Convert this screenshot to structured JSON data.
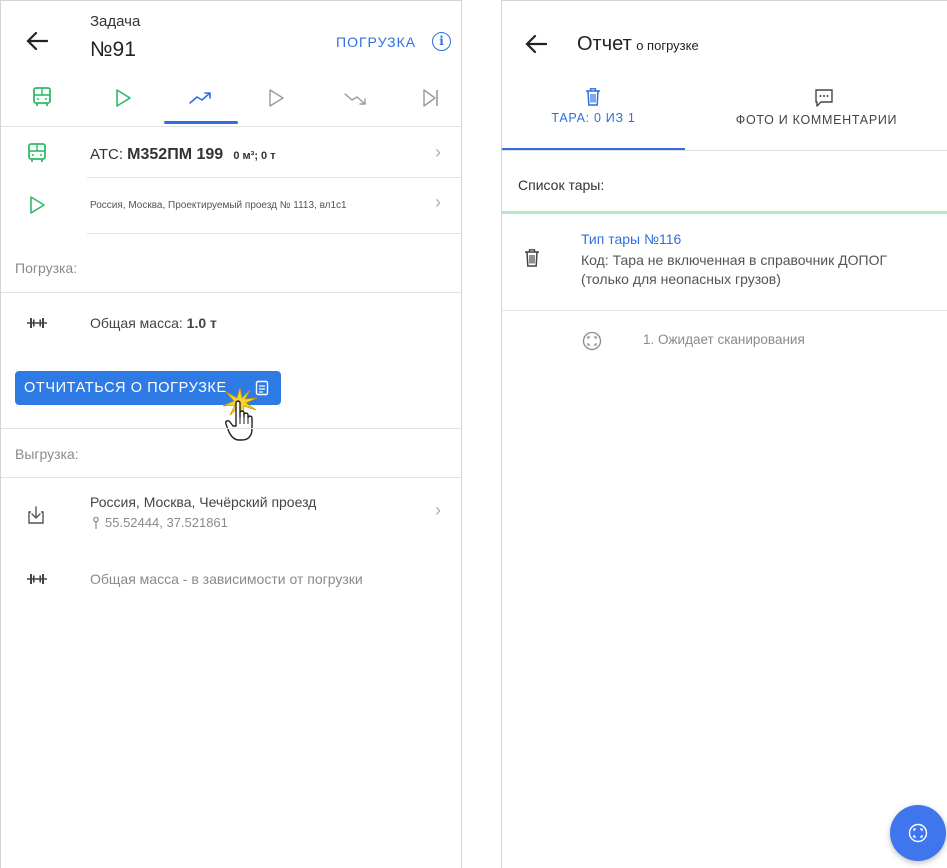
{
  "left": {
    "header": {
      "task_label": "Задача",
      "task_number": "№91",
      "stage": "ПОГРУЗКА",
      "info_icon": "info-icon"
    },
    "tabs": [
      {
        "icon": "bus-icon"
      },
      {
        "icon": "play-icon"
      },
      {
        "icon": "trend-up-icon",
        "active": true
      },
      {
        "icon": "play-outline-icon"
      },
      {
        "icon": "trend-down-icon"
      },
      {
        "icon": "skip-end-icon"
      }
    ],
    "vehicle": {
      "prefix": "АТС:",
      "plate": "М352ПМ 199",
      "capacity": "0 м³; 0 т"
    },
    "start_address": "Россия, Москва, Проектируемый проезд № 1113, вл1с1",
    "loading_section": "Погрузка:",
    "loading_mass_prefix": "Общая масса:",
    "loading_mass_value": "1.0 т",
    "report_button": "ОТЧИТАТЬСЯ О ПОГРУЗКЕ",
    "unloading_section": "Выгрузка:",
    "unloading_address": "Россия, Москва, Чечёрский проезд",
    "unloading_coords": "55.52444, 37.521861",
    "unloading_mass": "Общая масса - в зависимости от погрузки"
  },
  "right": {
    "header": {
      "title": "Отчет",
      "subtitle": "о погрузке"
    },
    "tabs": [
      {
        "label": "ТАРА: 0 ИЗ 1",
        "icon": "trash-icon",
        "active": true
      },
      {
        "label": "ФОТО И КОММЕНТАРИИ",
        "icon": "comment-icon",
        "active": false
      }
    ],
    "list_label": "Список тары:",
    "item": {
      "title": "Тип тары №116",
      "body": "Код: Тара не включенная в справочник ДОПОГ (только для неопасных грузов)"
    },
    "scan_status": "1. Ожидает сканирования"
  },
  "colors": {
    "accent": "#2f6fe0",
    "button": "#2f7be5",
    "green": "#2dbb6a",
    "fab": "#3f76ee"
  }
}
